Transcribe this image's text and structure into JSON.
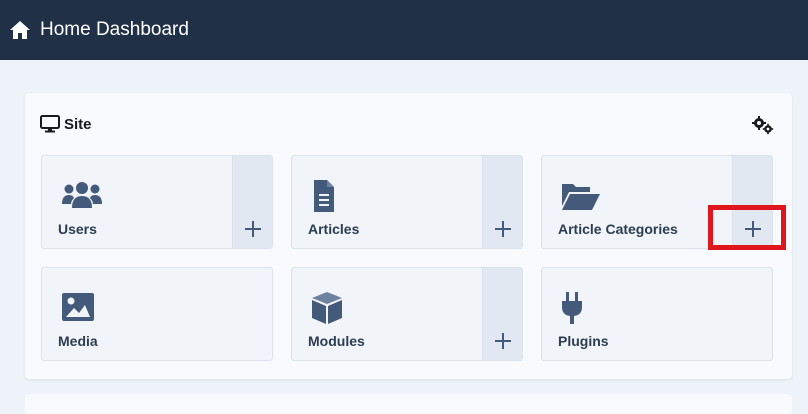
{
  "header": {
    "title": "Home Dashboard",
    "icon": "home-icon"
  },
  "card": {
    "title": "Site",
    "icon": "monitor-icon",
    "options_icon": "gears-icon"
  },
  "tiles": [
    {
      "label": "Users",
      "icon": "users-icon",
      "has_add": true
    },
    {
      "label": "Articles",
      "icon": "file-icon",
      "has_add": true
    },
    {
      "label": "Article Categories",
      "icon": "folder-open-icon",
      "has_add": true
    },
    {
      "label": "Media",
      "icon": "image-icon",
      "has_add": false
    },
    {
      "label": "Modules",
      "icon": "cube-icon",
      "has_add": true
    },
    {
      "label": "Plugins",
      "icon": "plug-icon",
      "has_add": false
    }
  ],
  "colors": {
    "header_bg": "#1f3047",
    "icon": "#435a7a",
    "highlight": "#e0161d"
  }
}
